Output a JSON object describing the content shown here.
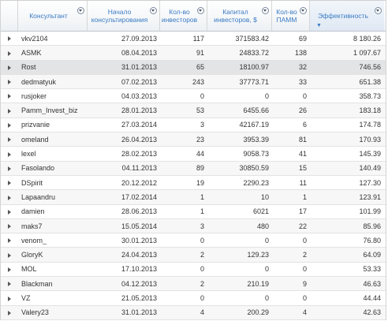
{
  "table": {
    "columns": [
      {
        "label": "Консультант",
        "filter_icon": "filter-icon",
        "sorted": false
      },
      {
        "label": "Начало\nконсультирования",
        "filter_icon": "filter-icon",
        "sorted": false
      },
      {
        "label": "Кол-во\nинвесторов",
        "filter_icon": "filter-icon",
        "sorted": false
      },
      {
        "label": "Капитал\nинвесторов, $",
        "filter_icon": "filter-icon",
        "sorted": false
      },
      {
        "label": "Кол-во\nПАММ",
        "filter_icon": "filter-icon",
        "sorted": false
      },
      {
        "label": "Эффективность",
        "filter_icon": "filter-icon",
        "sorted": true,
        "sort_direction": "desc"
      }
    ],
    "sort_indicator": "▼",
    "row_expander_icon": "expand-arrow-icon",
    "rows": [
      {
        "name": "vkv2104",
        "start": "27.09.2013",
        "investors": "117",
        "capital": "371583.42",
        "pamm": "69",
        "efficiency": "8 180.26"
      },
      {
        "name": "ASMK",
        "start": "08.04.2013",
        "investors": "91",
        "capital": "24833.72",
        "pamm": "138",
        "efficiency": "1 097.67"
      },
      {
        "name": "Rost",
        "start": "31.01.2013",
        "investors": "65",
        "capital": "18100.97",
        "pamm": "32",
        "efficiency": "746.56",
        "selected": true
      },
      {
        "name": "dedmatyuk",
        "start": "07.02.2013",
        "investors": "243",
        "capital": "37773.71",
        "pamm": "33",
        "efficiency": "651.38"
      },
      {
        "name": "rusjoker",
        "start": "04.03.2013",
        "investors": "0",
        "capital": "0",
        "pamm": "0",
        "efficiency": "358.73"
      },
      {
        "name": "Pamm_Invest_biz",
        "start": "28.01.2013",
        "investors": "53",
        "capital": "6455.66",
        "pamm": "26",
        "efficiency": "183.18"
      },
      {
        "name": "prizvanie",
        "start": "27.03.2014",
        "investors": "3",
        "capital": "42167.19",
        "pamm": "6",
        "efficiency": "174.78"
      },
      {
        "name": "omeland",
        "start": "26.04.2013",
        "investors": "23",
        "capital": "3953.39",
        "pamm": "81",
        "efficiency": "170.93"
      },
      {
        "name": "lexel",
        "start": "28.02.2013",
        "investors": "44",
        "capital": "9058.73",
        "pamm": "41",
        "efficiency": "145.39"
      },
      {
        "name": "Fasolando",
        "start": "04.11.2013",
        "investors": "89",
        "capital": "30850.59",
        "pamm": "15",
        "efficiency": "140.49"
      },
      {
        "name": "DSpirit",
        "start": "20.12.2012",
        "investors": "19",
        "capital": "2290.23",
        "pamm": "11",
        "efficiency": "127.30"
      },
      {
        "name": "Lapaandru",
        "start": "17.02.2014",
        "investors": "1",
        "capital": "10",
        "pamm": "1",
        "efficiency": "123.91"
      },
      {
        "name": "damien",
        "start": "28.06.2013",
        "investors": "1",
        "capital": "6021",
        "pamm": "17",
        "efficiency": "101.99"
      },
      {
        "name": "maks7",
        "start": "15.05.2014",
        "investors": "3",
        "capital": "480",
        "pamm": "22",
        "efficiency": "85.96"
      },
      {
        "name": "venom_",
        "start": "30.01.2013",
        "investors": "0",
        "capital": "0",
        "pamm": "0",
        "efficiency": "76.80"
      },
      {
        "name": "GloryK",
        "start": "24.04.2013",
        "investors": "2",
        "capital": "129.23",
        "pamm": "2",
        "efficiency": "64.09"
      },
      {
        "name": "MOL",
        "start": "17.10.2013",
        "investors": "0",
        "capital": "0",
        "pamm": "0",
        "efficiency": "53.33"
      },
      {
        "name": "Blackman",
        "start": "04.12.2013",
        "investors": "2",
        "capital": "210.19",
        "pamm": "9",
        "efficiency": "46.63"
      },
      {
        "name": "VZ",
        "start": "21.05.2013",
        "investors": "0",
        "capital": "0",
        "pamm": "0",
        "efficiency": "44.44"
      },
      {
        "name": "Valery23",
        "start": "31.01.2013",
        "investors": "4",
        "capital": "200.29",
        "pamm": "4",
        "efficiency": "42.63"
      }
    ]
  }
}
